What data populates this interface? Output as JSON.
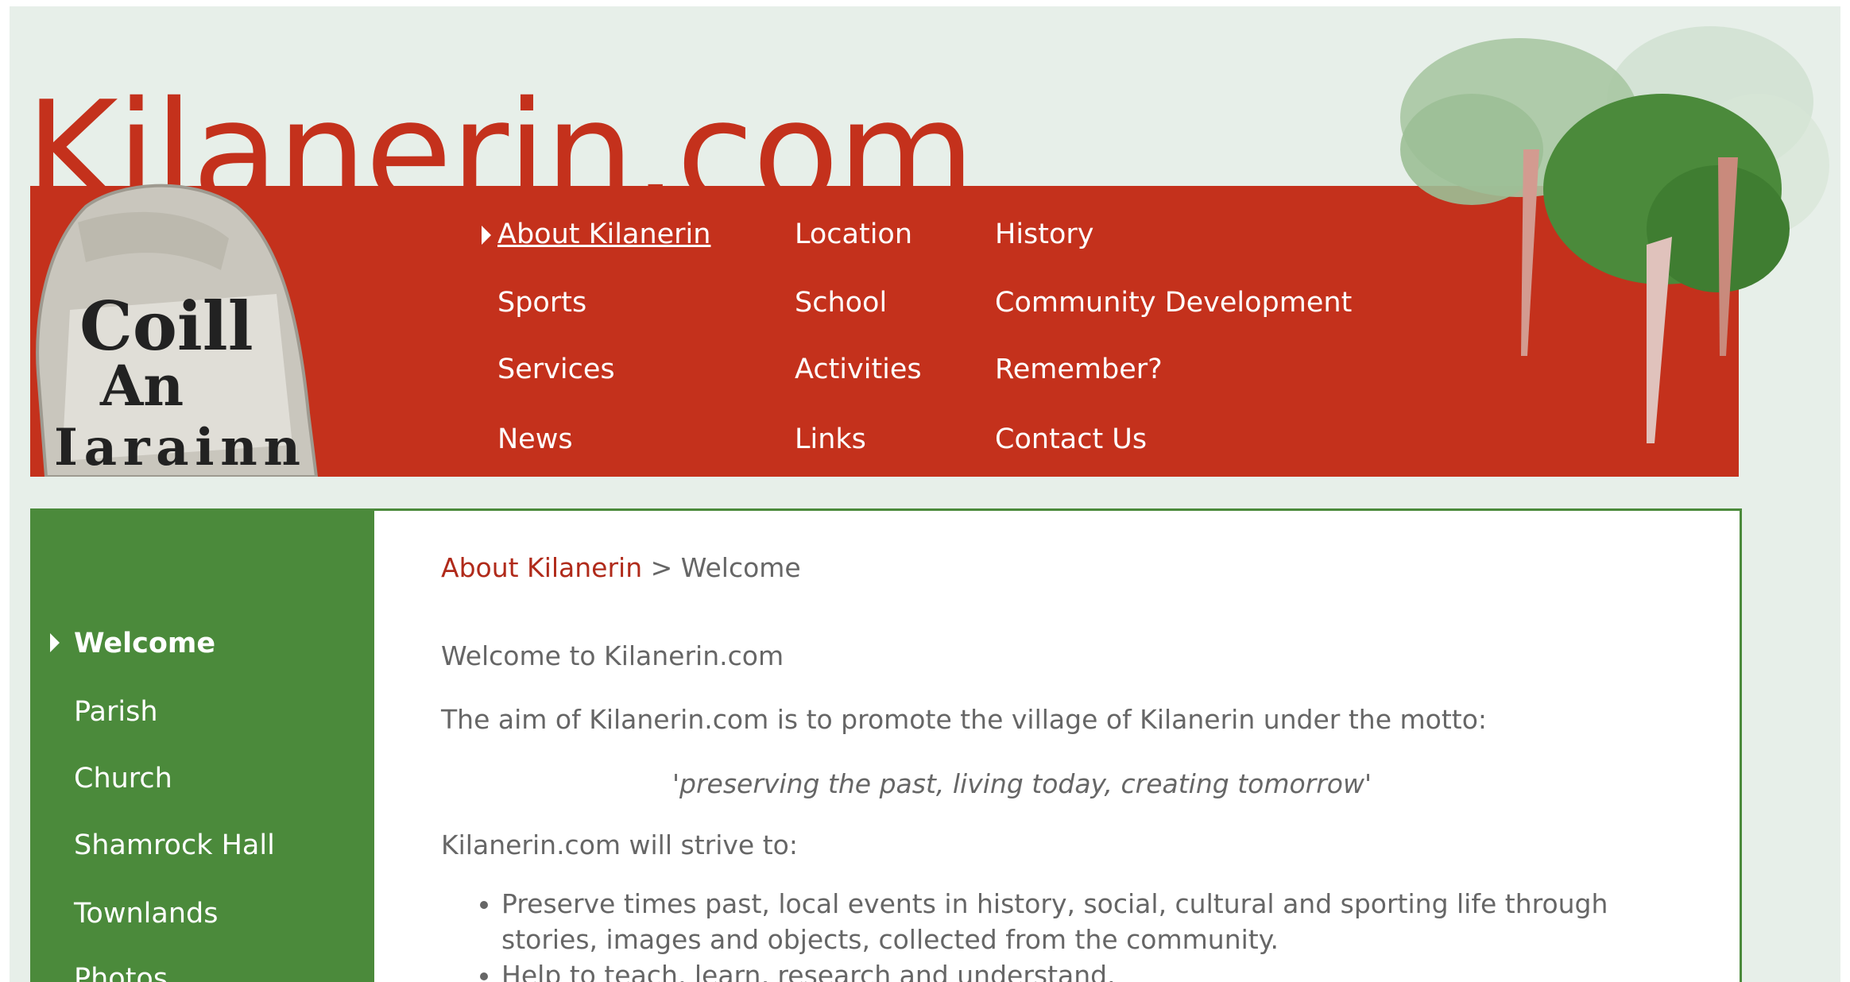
{
  "site": {
    "title": "Kilanerin.com",
    "stone_text": [
      "Coill",
      "An",
      "Iarainn"
    ],
    "colors": {
      "brand_red": "#c4311c",
      "brand_green": "#4b8a3b",
      "page_bg": "#e7efe9"
    }
  },
  "top_nav": {
    "items": [
      {
        "label": "About Kilanerin",
        "active": true
      },
      {
        "label": "Location"
      },
      {
        "label": "History"
      },
      {
        "label": "Sports"
      },
      {
        "label": "School"
      },
      {
        "label": "Community Development"
      },
      {
        "label": "Services"
      },
      {
        "label": "Activities"
      },
      {
        "label": "Remember?"
      },
      {
        "label": "News"
      },
      {
        "label": "Links"
      },
      {
        "label": "Contact Us"
      }
    ]
  },
  "sidebar": {
    "items": [
      {
        "label": "Welcome",
        "active": true
      },
      {
        "label": "Parish"
      },
      {
        "label": "Church"
      },
      {
        "label": "Shamrock Hall"
      },
      {
        "label": "Townlands"
      },
      {
        "label": "Photos"
      }
    ]
  },
  "content": {
    "breadcrumb": {
      "link": "About Kilanerin",
      "separator": ">",
      "current": "Welcome"
    },
    "heading": "Welcome to Kilanerin.com",
    "intro": "The aim of Kilanerin.com is to promote the village of Kilanerin under the motto:",
    "motto": "'preserving the past, living today, creating tomorrow'",
    "strive": "Kilanerin.com will strive to:",
    "bullets": [
      "Preserve times past, local events in history, social, cultural and sporting life through stories, images and objects, collected from the community.",
      "Help to teach, learn, research and understand."
    ]
  }
}
